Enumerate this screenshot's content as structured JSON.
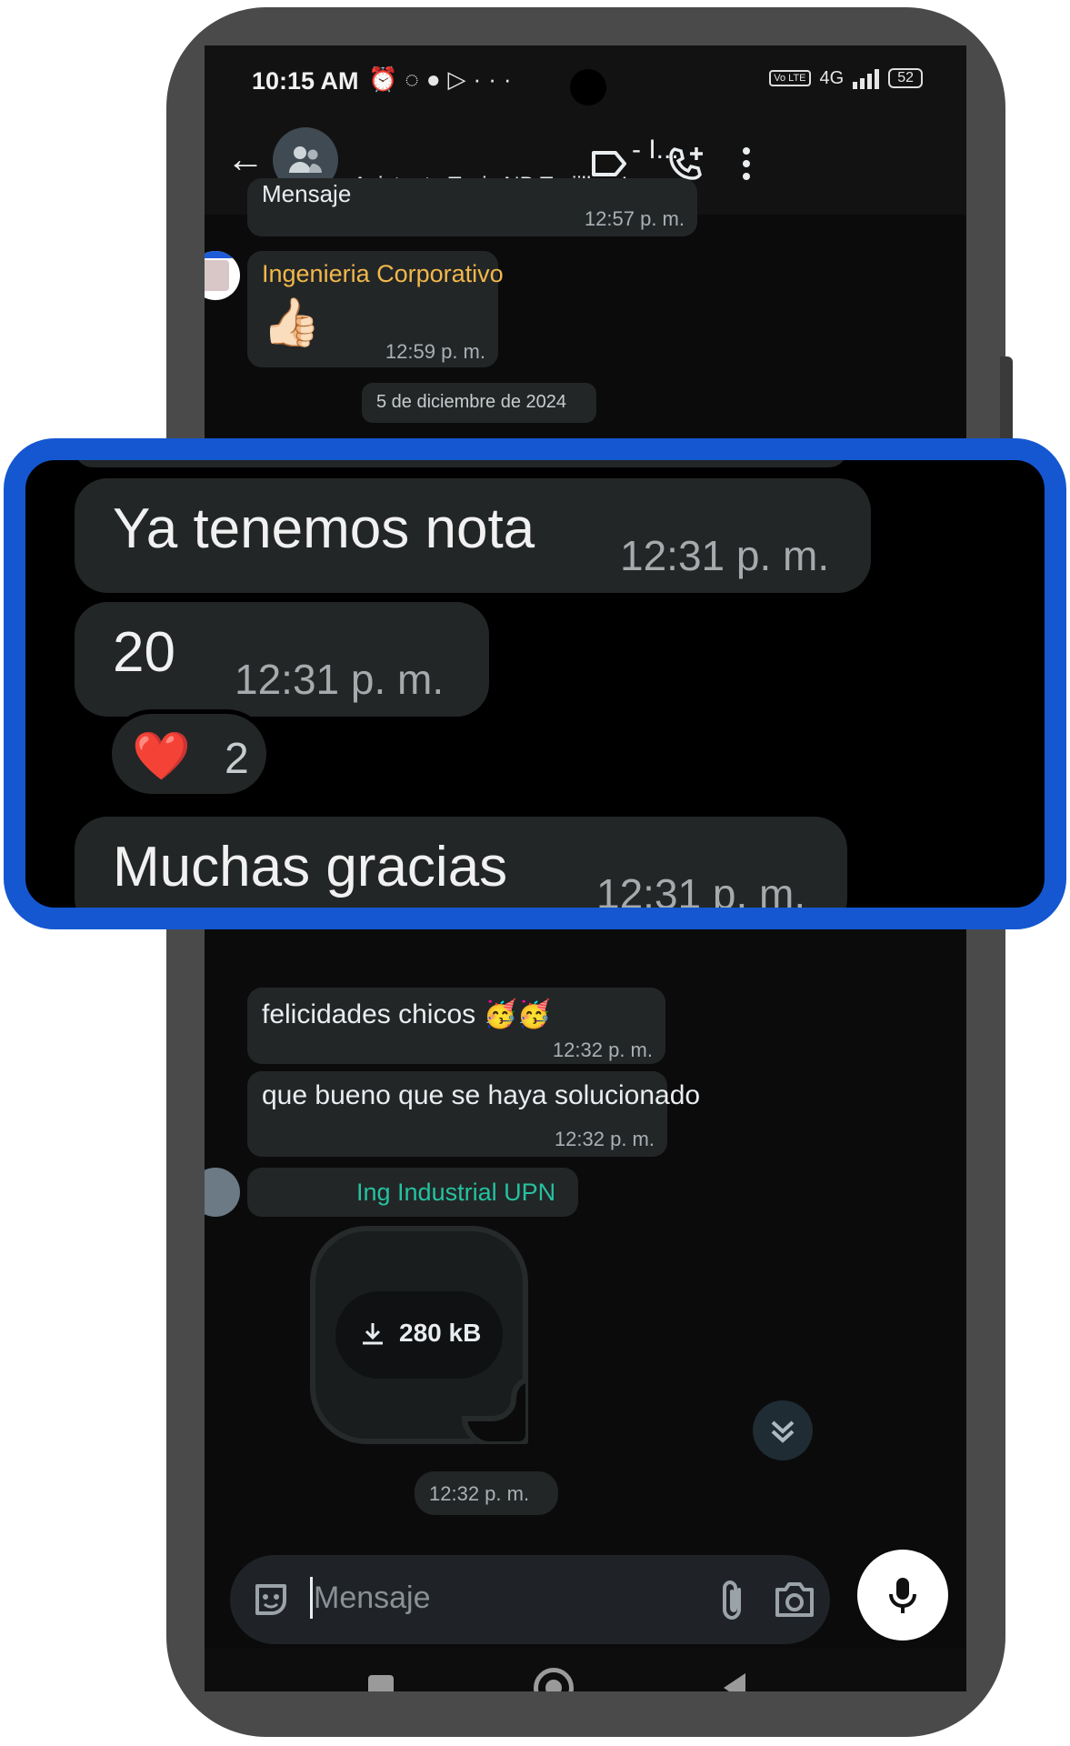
{
  "status_bar": {
    "time": "10:15 AM",
    "icons": [
      "alarm-icon",
      "whatsapp-status-icon",
      "chat-icon",
      "send-icon",
      "more-dots-icon"
    ],
    "network": "4G",
    "volte": "Vo LTE",
    "battery": "52"
  },
  "header": {
    "title": "- I...",
    "subtitle": "Asistente Tesis NB Trujillo , Ing..."
  },
  "messages": {
    "m0_time": "12:57 p. m.",
    "m0_text": "Mensaje",
    "m1_sender": "Ingenieria Corporativo",
    "m1_sender_color": "#f2b84b",
    "m1_emoji": "👍🏻",
    "m1_time": "12:59 p. m.",
    "date_chip": "5 de diciembre de 2024",
    "m5_text": "felicidades chicos 🥳🥳",
    "m5_time": "12:32 p. m.",
    "m6_text": "que bueno que se haya solucionado",
    "m6_time": "12:32 p. m.",
    "m7_sender": "Ing Industrial UPN",
    "m7_sender_color": "#25c2a0",
    "m7_download": "280 kB",
    "m7_time": "12:32 p. m."
  },
  "zoom": {
    "z1_text": "Ya tenemos nota",
    "z1_time": "12:31 p. m.",
    "z2_text": "20",
    "z2_time": "12:31 p. m.",
    "z2_reaction_emoji": "❤️",
    "z2_reaction_count": "2",
    "z3_text": "Muchas gracias",
    "z3_time": "12:31 p. m."
  },
  "input": {
    "placeholder": "Mensaje"
  },
  "colors": {
    "highlight_border": "#1457d1",
    "bubble": "#232627"
  }
}
